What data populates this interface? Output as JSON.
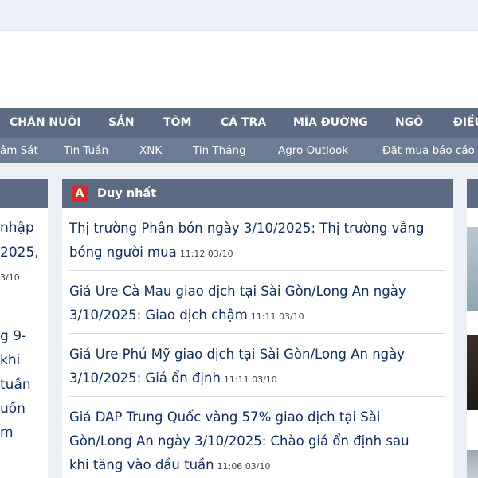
{
  "nav_primary": [
    {
      "label": "CHĂN NUÔI"
    },
    {
      "label": "SẮN"
    },
    {
      "label": "TÔM"
    },
    {
      "label": "CÁ TRA"
    },
    {
      "label": "MÍA ĐƯỜNG"
    },
    {
      "label": "NGÔ"
    },
    {
      "label": "ĐIỀU"
    }
  ],
  "nav_secondary": [
    {
      "label": "âm Sát"
    },
    {
      "label": "Tin Tuần"
    },
    {
      "label": "XNK"
    },
    {
      "label": "Tin Tháng"
    },
    {
      "label": "Agro Outlook"
    },
    {
      "label": "Đặt mua báo cáo"
    }
  ],
  "left_column": {
    "lines": [
      "nhập",
      "2025,",
      "g 9-",
      "khi",
      "tuần",
      "uồn",
      "m"
    ],
    "time": "3/10"
  },
  "main_column": {
    "badge": "A",
    "title": "Duy nhất",
    "articles": [
      {
        "title_line1": "Thị trường Phân bón ngày 3/10/2025: Thị trường vắng",
        "title_line2": "bóng người mua",
        "time": "11:12 03/10"
      },
      {
        "title_line1": "Giá Ure Cà Mau giao dịch tại Sài Gòn/Long An ngày",
        "title_line2": "3/10/2025: Giao dịch chậm",
        "time": "11:11 03/10"
      },
      {
        "title_line1": "Giá Ure Phú Mỹ giao dịch tại Sài Gòn/Long An ngày",
        "title_line2": "3/10/2025: Giá ổn định",
        "time": "11:11 03/10"
      },
      {
        "title_line1": "Giá DAP Trung Quốc vàng 57% giao dịch tại Sài",
        "title_line2": "Gòn/Long An ngày 3/10/2025: Chào giá ổn định sau",
        "title_line3": "khi tăng vào đầu tuần",
        "time": "11:06 03/10"
      }
    ]
  },
  "colors": {
    "nav_primary_bg": "#5c6b82",
    "nav_secondary_bg": "#6e7d96",
    "badge_red": "#d92a2a",
    "link_text": "#0f2d5a"
  }
}
